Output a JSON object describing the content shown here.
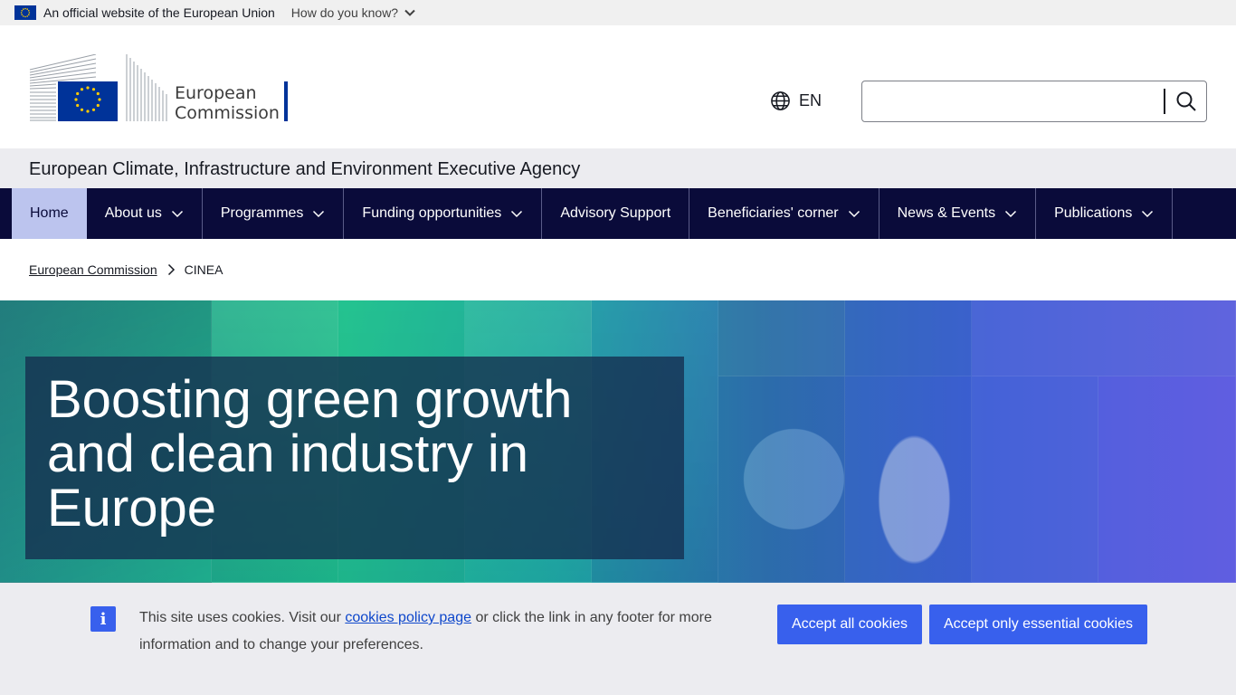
{
  "eu_banner": {
    "official_text": "An official website of the European Union",
    "how_know_text": "How do you know?"
  },
  "header": {
    "logo_line1": "European",
    "logo_line2": "Commission",
    "language": "EN",
    "search_placeholder": ""
  },
  "site_name": "European Climate, Infrastructure and Environment Executive Agency",
  "nav": {
    "items": [
      {
        "label": "Home",
        "active": true,
        "has_dropdown": false
      },
      {
        "label": "About us",
        "active": false,
        "has_dropdown": true
      },
      {
        "label": "Programmes",
        "active": false,
        "has_dropdown": true
      },
      {
        "label": "Funding opportunities",
        "active": false,
        "has_dropdown": true
      },
      {
        "label": "Advisory Support",
        "active": false,
        "has_dropdown": false
      },
      {
        "label": "Beneficiaries' corner",
        "active": false,
        "has_dropdown": true
      },
      {
        "label": "News & Events",
        "active": false,
        "has_dropdown": true
      },
      {
        "label": "Publications",
        "active": false,
        "has_dropdown": true
      }
    ]
  },
  "breadcrumb": {
    "items": [
      {
        "label": "European Commission",
        "link": true
      },
      {
        "label": "CINEA",
        "link": false
      }
    ]
  },
  "hero": {
    "title": "Boosting green growth and clean industry in Europe"
  },
  "cookie": {
    "text_before": "This site uses cookies. Visit our ",
    "link_text": "cookies policy page",
    "text_after": " or click the link in any footer for more information and to change your preferences.",
    "accept_all": "Accept all cookies",
    "accept_essential": "Accept only essential cookies"
  },
  "colors": {
    "nav_bg": "#0a0b3a",
    "nav_active_bg": "#bcc4ee",
    "primary_button": "#3860ed",
    "eu_blue": "#003399",
    "eu_yellow": "#ffcc00"
  },
  "icons": {
    "flag": "eu-flag-icon",
    "chevron": "chevron-down-icon",
    "globe": "globe-icon",
    "search": "search-icon",
    "breadcrumb_separator": "chevron-right-icon",
    "info": "info-icon"
  }
}
